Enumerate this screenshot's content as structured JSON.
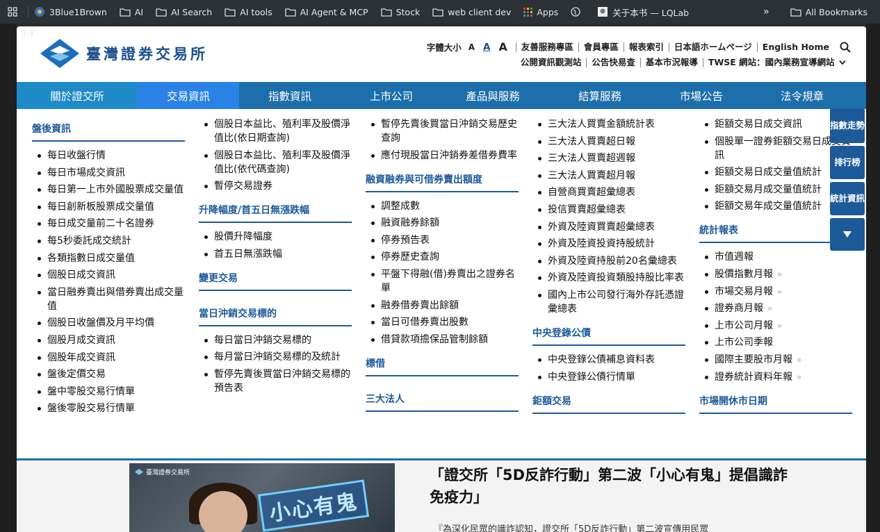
{
  "bookmarks": {
    "items": [
      {
        "label": "3Blue1Brown",
        "icon": "youtube-channel-icon"
      },
      {
        "label": "AI",
        "icon": "folder-icon"
      },
      {
        "label": "AI Search",
        "icon": "folder-icon"
      },
      {
        "label": "AI tools",
        "icon": "folder-icon"
      },
      {
        "label": "AI Agent & MCP",
        "icon": "folder-icon"
      },
      {
        "label": "Stock",
        "icon": "folder-icon"
      },
      {
        "label": "web client dev",
        "icon": "folder-icon"
      },
      {
        "label": "Apps",
        "icon": "apps-grid-icon"
      },
      {
        "label": "",
        "icon": "globe-icon"
      },
      {
        "label": "关于本书 — LQLab",
        "icon": "site-favicon-icon"
      }
    ],
    "more": "»",
    "all_bookmarks": "All Bookmarks"
  },
  "site": {
    "logo_text": "臺灣證券交易所",
    "font_size_label": "字體大小",
    "font_sizes": [
      "A",
      "A",
      "A"
    ],
    "top_links": [
      "友善服務專區",
      "會員專區",
      "報表索引",
      "日本語ホームページ",
      "English Home"
    ],
    "second_links": [
      "公開資訊觀測站",
      "公告快易查",
      "基本市況報導",
      "TWSE 網站：國內業務宣導網站"
    ],
    "brand_color": "#1c6fab",
    "nav": [
      "關於證交所",
      "交易資訊",
      "指數資訊",
      "上市公司",
      "產品與服務",
      "結算服務",
      "市場公告",
      "法令規章"
    ],
    "active_nav": "交易資訊"
  },
  "mega": {
    "col1": {
      "title": "盤後資訊",
      "items": [
        "每日收盤行情",
        "每日市場成交資訊",
        "每日第一上市外國股票成交量值",
        "每日創新板股票成交量值",
        "每日成交量前二十名證券",
        "每5秒委託成交統計",
        "各類指數日成交量值",
        "個股日成交資訊",
        "當日融券賣出與借券賣出成交量值",
        "個股日收盤價及月平均價",
        "個股月成交資訊",
        "個股年成交資訊",
        "盤後定價交易",
        "盤中零股交易行情單",
        "盤後零股交易行情單"
      ]
    },
    "col2": {
      "items": [
        "個股日本益比、殖利率及股價淨值比(依日期查詢)",
        "個股日本益比、殖利率及股價淨值比(依代碼查詢)",
        "暫停交易證券"
      ],
      "sec1_title": "升降幅度/首五日無漲跌幅",
      "sec1_items": [
        "股價升降幅度",
        "首五日無漲跌幅"
      ],
      "sec2_title": "變更交易",
      "sec3_title": "當日沖銷交易標的",
      "sec3_items": [
        "每日當日沖銷交易標的",
        "每月當日沖銷交易標的及統計",
        "暫停先賣後買當日沖銷交易標的預告表"
      ]
    },
    "col3": {
      "items": [
        "暫停先賣後買當日沖銷交易歷史查詢",
        "應付現股當日沖銷券差借券費率"
      ],
      "sec1_title": "融資融券與可借券賣出額度",
      "sec1_items": [
        "調整成數",
        "融資融券餘額",
        "停券預告表",
        "停券歷史查詢",
        "平盤下得融(借)券賣出之證券名單",
        "融券借券賣出餘額",
        "當日可借券賣出股數",
        "借貸款項擔保品管制餘額"
      ],
      "sec2_title": "標借",
      "sec3_title": "三大法人"
    },
    "col4": {
      "items": [
        "三大法人買賣金額統計表",
        "三大法人買賣超日報",
        "三大法人買賣超週報",
        "三大法人買賣超月報",
        "自營商買賣超彙總表",
        "投信買賣超彙總表",
        "外資及陸資買賣超彙總表",
        "外資及陸資投資持股統計",
        "外資及陸資持股前20名彙總表",
        "外資及陸資投資類股持股比率表",
        "國內上市公司發行海外存託憑證彙總表"
      ],
      "sec1_title": "中央登錄公債",
      "sec1_items": [
        "中央登錄公債補息資料表",
        "中央登錄公債行情單"
      ],
      "sec2_title": "鉅額交易"
    },
    "col5": {
      "items": [
        "鉅額交易日成交資訊",
        "個股單一證券鉅額交易日成交資訊",
        "鉅額交易日成交量值統計",
        "鉅額交易月成交量值統計",
        "鉅額交易年成交量值統計"
      ],
      "sec1_title": "統計報表",
      "sec1_items": [
        {
          "label": "市值週報",
          "arrow": ""
        },
        {
          "label": "股價指數月報",
          "arrow": "»"
        },
        {
          "label": "市場交易月報",
          "arrow": "»"
        },
        {
          "label": "證券商月報",
          "arrow": "»"
        },
        {
          "label": "上市公司月報",
          "arrow": "»"
        },
        {
          "label": "上市公司季報",
          "arrow": ""
        },
        {
          "label": "國際主要股市月報",
          "arrow": "»"
        },
        {
          "label": "證券統計資料年報",
          "arrow": "»"
        }
      ],
      "sec2_title": "市場開休市日期"
    }
  },
  "floating": {
    "items": [
      "指數走勢",
      "排行榜",
      "統計資訊"
    ],
    "toggle_icon": "caret-down-icon"
  },
  "news": {
    "image_logo": "臺灣證券交易所",
    "image_stamp": "小心有鬼",
    "title": "「證交所「5D反詐行動」第二波「小心有鬼」提倡識詐免疫力」",
    "desc": "『為深化民眾的識詐認知，證交所「5D反詐行動」第二波宣傳用民眾"
  }
}
